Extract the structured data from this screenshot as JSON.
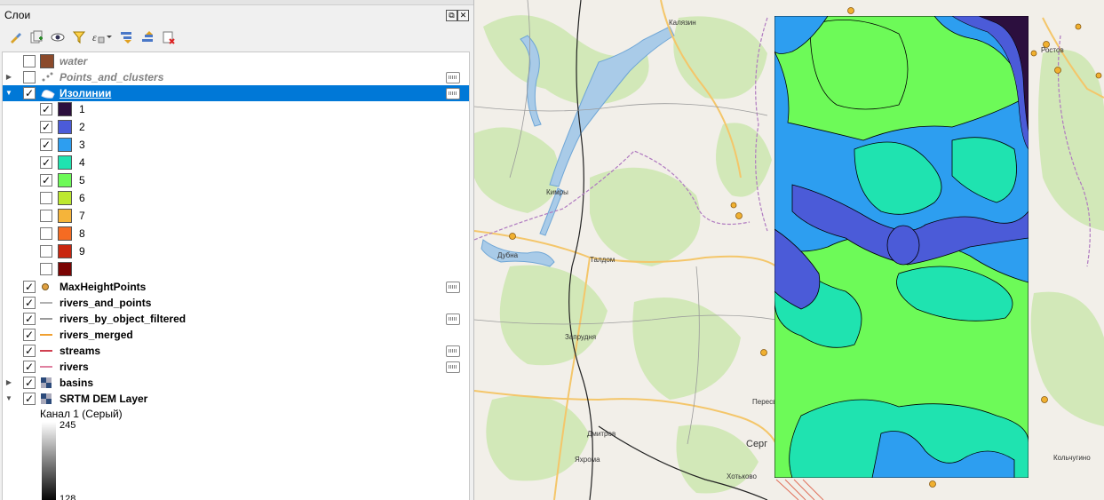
{
  "panel": {
    "title": "Слои",
    "float_btn": "⧉",
    "close_btn": "✕",
    "toolbar_icons": [
      "style-brush-icon",
      "add-group-icon",
      "visibility-eye-icon",
      "filter-icon",
      "expression-filter-icon",
      "expand-all-icon",
      "collapse-all-icon",
      "remove-layer-icon"
    ]
  },
  "layers": {
    "water": "water",
    "points_clusters": "Points_and_clusters",
    "isolines": "Изолинии",
    "classes": [
      {
        "label": "1",
        "color": "#2c0f3e",
        "checked": true
      },
      {
        "label": "2",
        "color": "#4b5bd8",
        "checked": true
      },
      {
        "label": "3",
        "color": "#2d9ef0",
        "checked": true
      },
      {
        "label": "4",
        "color": "#1fe3b0",
        "checked": true
      },
      {
        "label": "5",
        "color": "#6dfa58",
        "checked": true
      },
      {
        "label": "6",
        "color": "#bde82f",
        "checked": false
      },
      {
        "label": "7",
        "color": "#f5b43a",
        "checked": false
      },
      {
        "label": "8",
        "color": "#f56b22",
        "checked": false
      },
      {
        "label": "9",
        "color": "#c9260f",
        "checked": false
      },
      {
        "label": "",
        "color": "#7a0403",
        "checked": false
      }
    ],
    "maxheight": "MaxHeightPoints",
    "rivers_points": "rivers_and_points",
    "rivers_filtered": "rivers_by_object_filtered",
    "rivers_merged": "rivers_merged",
    "streams": "streams",
    "rivers": "rivers",
    "basins": "basins",
    "srtm": "SRTM DEM Layer",
    "channel": "Канал 1 (Серый)",
    "ramp_max": "245",
    "ramp_min": "128"
  },
  "colors": {
    "selection": "#0078d7",
    "water_swatch": "#8b4a2b",
    "rivers_points_line": "#b0b0b0",
    "rivers_filtered_line": "#9a9a9a",
    "rivers_merged_line": "#f0a030",
    "streams_line": "#d04050",
    "rivers_line": "#e080a0",
    "maxheight_dot": "#e0a040"
  },
  "map": {
    "labels": {
      "kalyazin": "Калязин",
      "rostov": "Ростов",
      "kimry": "Кимры",
      "dubna": "Дубна",
      "taldom": "Талдом",
      "zaprudnya": "Запрудня",
      "dmitrov": "Дмитров",
      "yakhroma": "Яхрома",
      "sergiev": "Серг",
      "peresvet": "Пересв",
      "khotkovo": "Хотьково",
      "kolchugino": "Кольчугино"
    }
  }
}
